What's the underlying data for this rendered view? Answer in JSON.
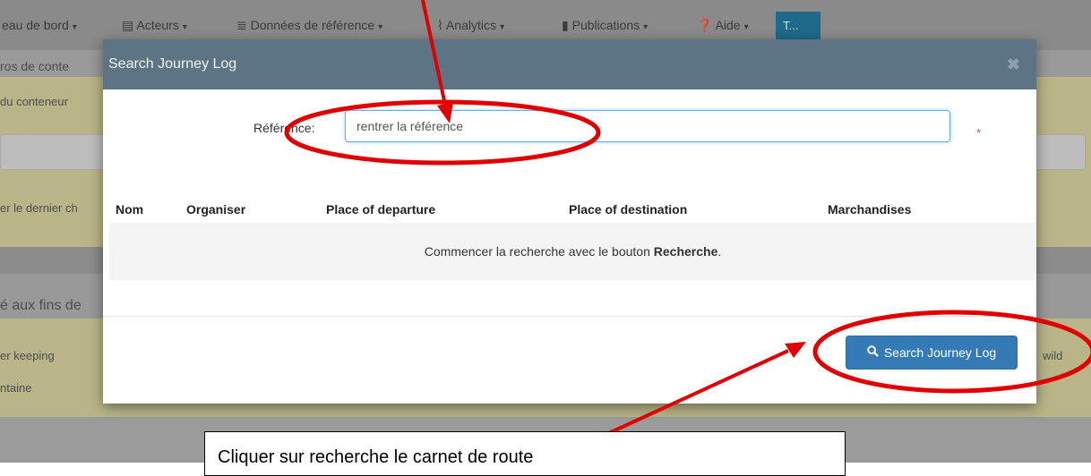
{
  "navbar": {
    "items": [
      {
        "label": "eau de bord",
        "icon": "dashboard-icon"
      },
      {
        "label": "Acteurs",
        "icon": "id-card-icon"
      },
      {
        "label": "Données de référence",
        "icon": "database-icon"
      },
      {
        "label": "Analytics",
        "icon": "line-chart-icon"
      },
      {
        "label": "Publications",
        "icon": "book-icon"
      },
      {
        "label": "Aide",
        "icon": "question-circle-icon"
      }
    ],
    "user_badge": "T..."
  },
  "background": {
    "row1": "ros de conte",
    "row2": "du conteneur",
    "row3": "er le dernier ch",
    "row4": "é aux fins de",
    "row5": "er keeping",
    "row6": "ntaine",
    "right_text": "wild"
  },
  "modal": {
    "title": "Search Journey Log",
    "close_icon": "close-icon",
    "reference_label": "Référence:",
    "reference_value": "rentrer la référence",
    "required_mark": "*",
    "columns": [
      "Nom",
      "Organiser",
      "Place of departure",
      "Place of destination",
      "Marchandises"
    ],
    "empty_message_prefix": "Commencer la recherche avec le bouton ",
    "empty_message_bold": "Recherche",
    "empty_message_suffix": ".",
    "search_button_label": "Search Journey Log",
    "search_button_icon": "search-icon"
  },
  "annotation": {
    "callout_text": "Cliquer sur recherche le carnet de route",
    "highlight_color": "#e00000"
  }
}
